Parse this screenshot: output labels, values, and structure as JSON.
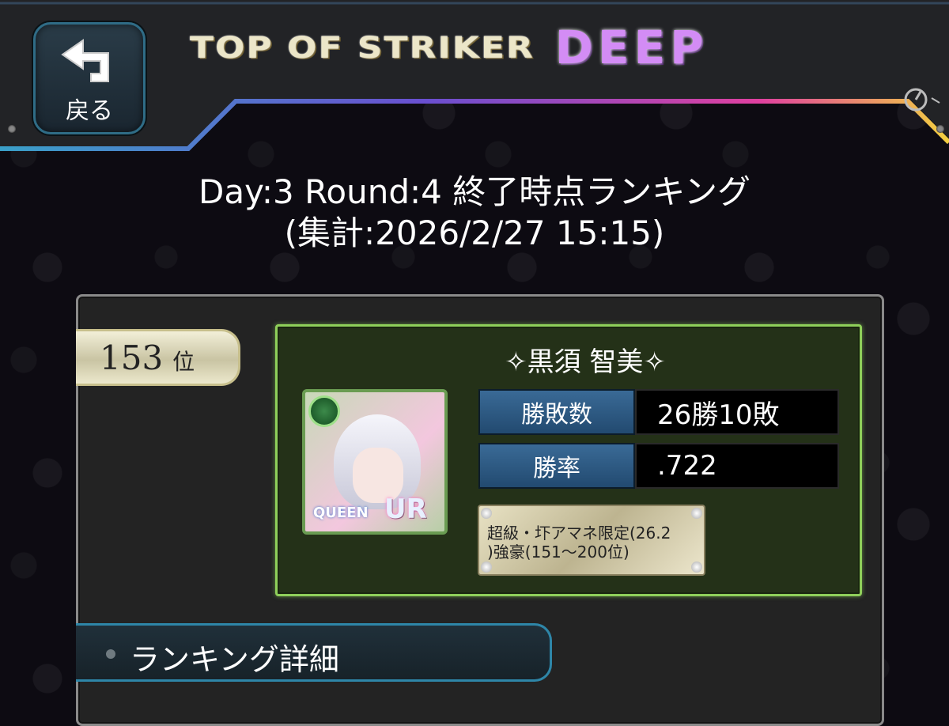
{
  "header": {
    "back_label": "戻る",
    "logo_main": "TOP OF STRIKER",
    "logo_sub": "DEEP"
  },
  "ranking": {
    "title": "Day:3 Round:4 終了時点ランキング",
    "subtitle": "(集計:2026/2/27 15:15)",
    "rank": "153",
    "rank_suffix": "位"
  },
  "player": {
    "name": "✧黒須 智美✧",
    "card_tags": {
      "queen": "QUEEN",
      "rarity": "UR"
    },
    "stats": [
      {
        "label": "勝敗数",
        "value": "26勝10敗"
      },
      {
        "label": "勝率",
        "value": ".722"
      }
    ],
    "title_plate_line1": "超級・圷アマネ限定(26.2",
    "title_plate_line2": ")強豪(151〜200位)"
  },
  "detail_section": {
    "label": "ランキング詳細"
  },
  "colors": {
    "card_border": "#8fcf5a",
    "stat_label_bg": "#2d5a85",
    "detail_border": "#2e86a8",
    "logo_deep": "#d38cf5"
  },
  "icons": [
    "back-arrow-icon",
    "knob-icon"
  ]
}
